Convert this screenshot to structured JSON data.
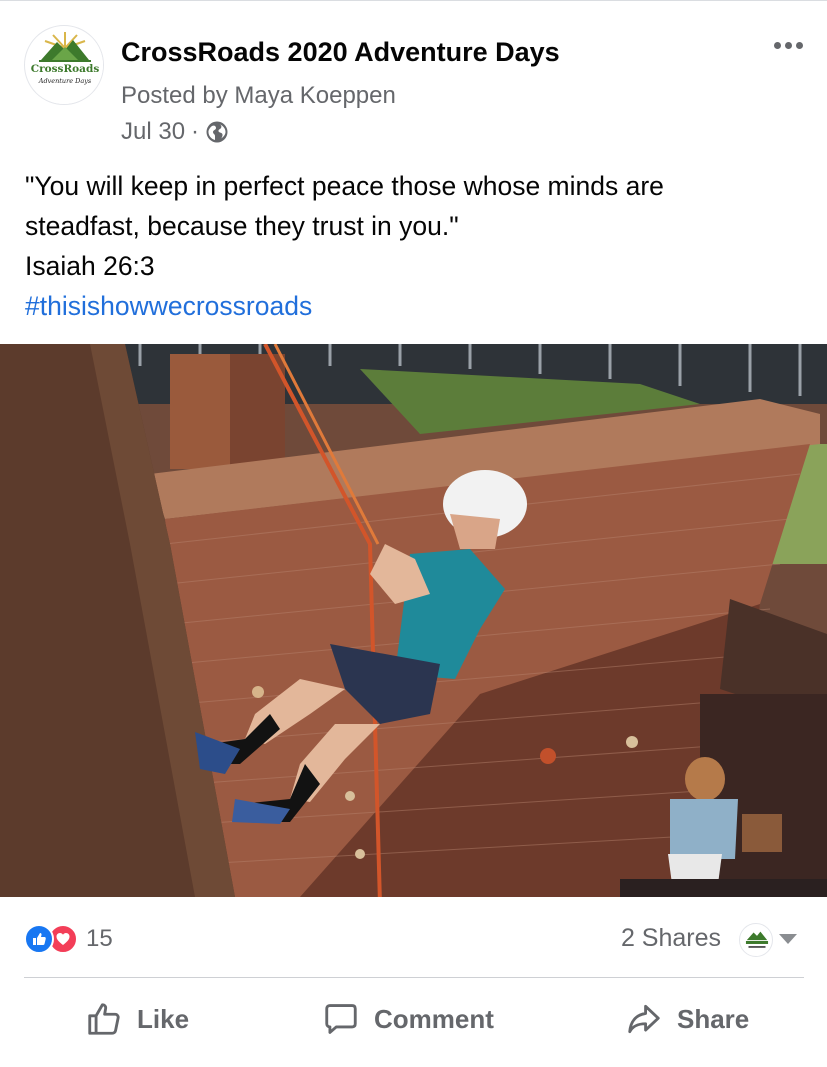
{
  "post": {
    "page_name": "CrossRoads 2020 Adventure Days",
    "posted_by": "Posted by Maya Koeppen",
    "date": "Jul 30",
    "separator": "·",
    "audience_icon": "globe-icon",
    "more_icon": "more-options-icon",
    "text_line_1": "\"You will keep in perfect peace those whose minds are",
    "text_line_2": "steadfast, because they trust in you.\"",
    "text_line_3": "Isaiah 26:3",
    "hashtag": "#thisishowwecrossroads"
  },
  "logo": {
    "name_top": "CrossRoads",
    "name_bottom": "Adventure Days"
  },
  "engagement": {
    "reaction_count": "15",
    "reaction_icons": [
      "like-reaction-icon",
      "love-reaction-icon"
    ],
    "shares": "2 Shares"
  },
  "actions": {
    "like_label": "Like",
    "comment_label": "Comment",
    "share_label": "Share"
  },
  "colors": {
    "hashtag": "#216fdb",
    "like_blue": "#1877f2",
    "love_red": "#f33e58",
    "secondary_text": "#65676b",
    "logo_green": "#3d7a2c"
  }
}
